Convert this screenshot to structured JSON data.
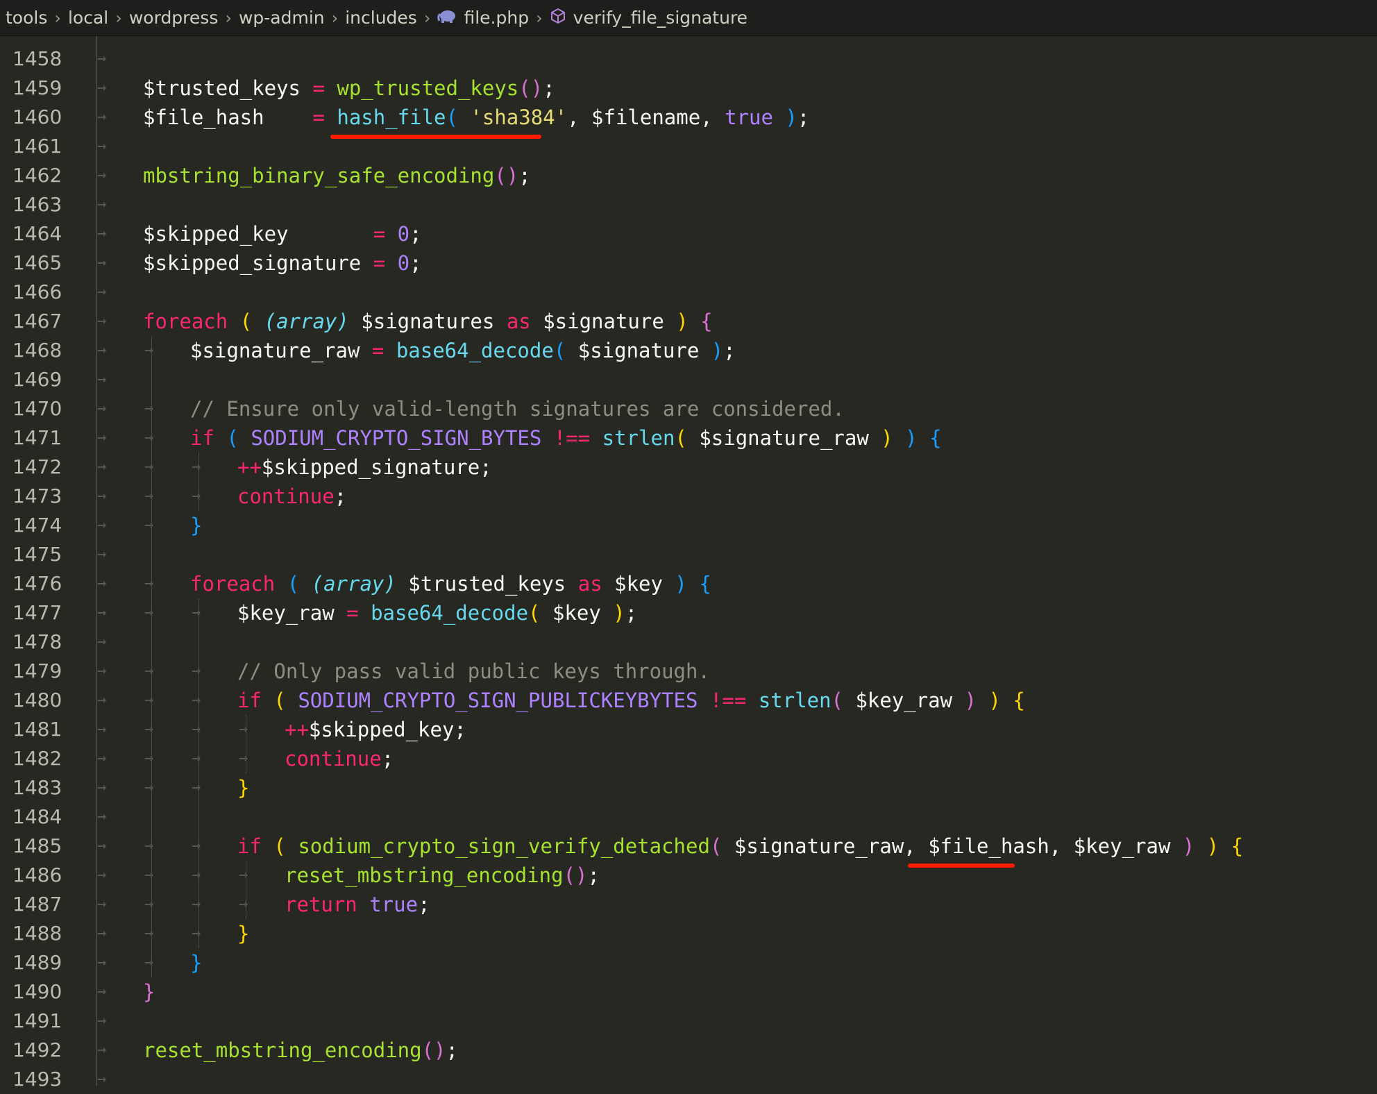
{
  "breadcrumb": {
    "items": [
      "tools",
      "local",
      "wordpress",
      "wp-admin",
      "includes",
      "file.php",
      "verify_file_signature"
    ],
    "file_icon": "php-elephant-icon",
    "symbol_icon": "method-cube-icon"
  },
  "colors": {
    "background": "#272822",
    "variable": "#f8f8f2",
    "function": "#a6e22e",
    "builtin": "#66d9ef",
    "keyword": "#f92672",
    "string": "#e6db74",
    "constant": "#ae81ff",
    "comment": "#8f8d7f",
    "annotation_underline": "#ff1a00"
  },
  "lines": [
    {
      "n": "1458",
      "indent": 0,
      "tokens": []
    },
    {
      "n": "1459",
      "indent": 1,
      "tokens": [
        [
          "var",
          "$trusted_keys "
        ],
        [
          "op",
          "= "
        ],
        [
          "fn",
          "wp_trusted_keys"
        ],
        [
          "p2",
          "()"
        ],
        [
          "var",
          ";"
        ]
      ]
    },
    {
      "n": "1460",
      "indent": 1,
      "tokens": [
        [
          "var",
          "$file_hash    "
        ],
        [
          "op",
          "= "
        ],
        [
          "bfn",
          "hash_file"
        ],
        [
          "p3",
          "( "
        ],
        [
          "str",
          "'sha384'"
        ],
        [
          "var",
          ", $filename, "
        ],
        [
          "const",
          "true"
        ],
        [
          "p3",
          " )"
        ],
        [
          "var",
          ";"
        ]
      ]
    },
    {
      "n": "1461",
      "indent": 0,
      "tokens": []
    },
    {
      "n": "1462",
      "indent": 1,
      "tokens": [
        [
          "fn",
          "mbstring_binary_safe_encoding"
        ],
        [
          "p2",
          "()"
        ],
        [
          "var",
          ";"
        ]
      ]
    },
    {
      "n": "1463",
      "indent": 0,
      "tokens": []
    },
    {
      "n": "1464",
      "indent": 1,
      "tokens": [
        [
          "var",
          "$skipped_key       "
        ],
        [
          "op",
          "= "
        ],
        [
          "num",
          "0"
        ],
        [
          "var",
          ";"
        ]
      ]
    },
    {
      "n": "1465",
      "indent": 1,
      "tokens": [
        [
          "var",
          "$skipped_signature "
        ],
        [
          "op",
          "= "
        ],
        [
          "num",
          "0"
        ],
        [
          "var",
          ";"
        ]
      ]
    },
    {
      "n": "1466",
      "indent": 0,
      "tokens": []
    },
    {
      "n": "1467",
      "indent": 1,
      "tokens": [
        [
          "kw",
          "foreach "
        ],
        [
          "p1",
          "( "
        ],
        [
          "cast",
          "(array)"
        ],
        [
          "var",
          " $signatures "
        ],
        [
          "kw",
          "as"
        ],
        [
          "var",
          " $signature "
        ],
        [
          "p1",
          ") "
        ],
        [
          "p2",
          "{"
        ]
      ]
    },
    {
      "n": "1468",
      "indent": 2,
      "tokens": [
        [
          "var",
          "$signature_raw "
        ],
        [
          "op",
          "= "
        ],
        [
          "bfn",
          "base64_decode"
        ],
        [
          "p3",
          "( "
        ],
        [
          "var",
          "$signature "
        ],
        [
          "p3",
          ")"
        ],
        [
          "var",
          ";"
        ]
      ]
    },
    {
      "n": "1469",
      "indent": 0,
      "tokens": []
    },
    {
      "n": "1470",
      "indent": 2,
      "tokens": [
        [
          "com",
          "// Ensure only valid-length signatures are considered."
        ]
      ]
    },
    {
      "n": "1471",
      "indent": 2,
      "tokens": [
        [
          "kw",
          "if "
        ],
        [
          "p3",
          "( "
        ],
        [
          "const",
          "SODIUM_CRYPTO_SIGN_BYTES "
        ],
        [
          "op",
          "!== "
        ],
        [
          "bfn",
          "strlen"
        ],
        [
          "p1",
          "( "
        ],
        [
          "var",
          "$signature_raw "
        ],
        [
          "p1",
          ") "
        ],
        [
          "p3",
          ") {"
        ]
      ]
    },
    {
      "n": "1472",
      "indent": 3,
      "tokens": [
        [
          "op",
          "++"
        ],
        [
          "var",
          "$skipped_signature;"
        ]
      ]
    },
    {
      "n": "1473",
      "indent": 3,
      "tokens": [
        [
          "kw",
          "continue"
        ],
        [
          "var",
          ";"
        ]
      ]
    },
    {
      "n": "1474",
      "indent": 2,
      "tokens": [
        [
          "p3",
          "}"
        ]
      ]
    },
    {
      "n": "1475",
      "indent": 0,
      "tokens": []
    },
    {
      "n": "1476",
      "indent": 2,
      "tokens": [
        [
          "kw",
          "foreach "
        ],
        [
          "p3",
          "( "
        ],
        [
          "cast",
          "(array)"
        ],
        [
          "var",
          " $trusted_keys "
        ],
        [
          "kw",
          "as"
        ],
        [
          "var",
          " $key "
        ],
        [
          "p3",
          ") {"
        ]
      ]
    },
    {
      "n": "1477",
      "indent": 3,
      "tokens": [
        [
          "var",
          "$key_raw "
        ],
        [
          "op",
          "= "
        ],
        [
          "bfn",
          "base64_decode"
        ],
        [
          "p1",
          "( "
        ],
        [
          "var",
          "$key "
        ],
        [
          "p1",
          ")"
        ],
        [
          "var",
          ";"
        ]
      ]
    },
    {
      "n": "1478",
      "indent": 0,
      "tokens": []
    },
    {
      "n": "1479",
      "indent": 3,
      "tokens": [
        [
          "com",
          "// Only pass valid public keys through."
        ]
      ]
    },
    {
      "n": "1480",
      "indent": 3,
      "tokens": [
        [
          "kw",
          "if "
        ],
        [
          "p1",
          "( "
        ],
        [
          "const",
          "SODIUM_CRYPTO_SIGN_PUBLICKEYBYTES "
        ],
        [
          "op",
          "!== "
        ],
        [
          "bfn",
          "strlen"
        ],
        [
          "p2",
          "( "
        ],
        [
          "var",
          "$key_raw "
        ],
        [
          "p2",
          ") "
        ],
        [
          "p1",
          ") {"
        ]
      ]
    },
    {
      "n": "1481",
      "indent": 4,
      "tokens": [
        [
          "op",
          "++"
        ],
        [
          "var",
          "$skipped_key;"
        ]
      ]
    },
    {
      "n": "1482",
      "indent": 4,
      "tokens": [
        [
          "kw",
          "continue"
        ],
        [
          "var",
          ";"
        ]
      ]
    },
    {
      "n": "1483",
      "indent": 3,
      "tokens": [
        [
          "p1",
          "}"
        ]
      ]
    },
    {
      "n": "1484",
      "indent": 0,
      "tokens": []
    },
    {
      "n": "1485",
      "indent": 3,
      "tokens": [
        [
          "kw",
          "if "
        ],
        [
          "p1",
          "( "
        ],
        [
          "fn",
          "sodium_crypto_sign_verify_detached"
        ],
        [
          "p2",
          "( "
        ],
        [
          "var",
          "$signature_raw, $file_hash, $key_raw "
        ],
        [
          "p2",
          ") "
        ],
        [
          "p1",
          ") {"
        ]
      ]
    },
    {
      "n": "1486",
      "indent": 4,
      "tokens": [
        [
          "fn",
          "reset_mbstring_encoding"
        ],
        [
          "p2",
          "()"
        ],
        [
          "var",
          ";"
        ]
      ]
    },
    {
      "n": "1487",
      "indent": 4,
      "tokens": [
        [
          "kw",
          "return "
        ],
        [
          "const",
          "true"
        ],
        [
          "var",
          ";"
        ]
      ]
    },
    {
      "n": "1488",
      "indent": 3,
      "tokens": [
        [
          "p1",
          "}"
        ]
      ]
    },
    {
      "n": "1489",
      "indent": 2,
      "tokens": [
        [
          "p3",
          "}"
        ]
      ]
    },
    {
      "n": "1490",
      "indent": 1,
      "tokens": [
        [
          "p2",
          "}"
        ]
      ]
    },
    {
      "n": "1491",
      "indent": 0,
      "tokens": []
    },
    {
      "n": "1492",
      "indent": 1,
      "tokens": [
        [
          "fn",
          "reset_mbstring_encoding"
        ],
        [
          "p2",
          "()"
        ],
        [
          "var",
          ";"
        ]
      ]
    },
    {
      "n": "1493",
      "indent": 0,
      "tokens": []
    }
  ]
}
